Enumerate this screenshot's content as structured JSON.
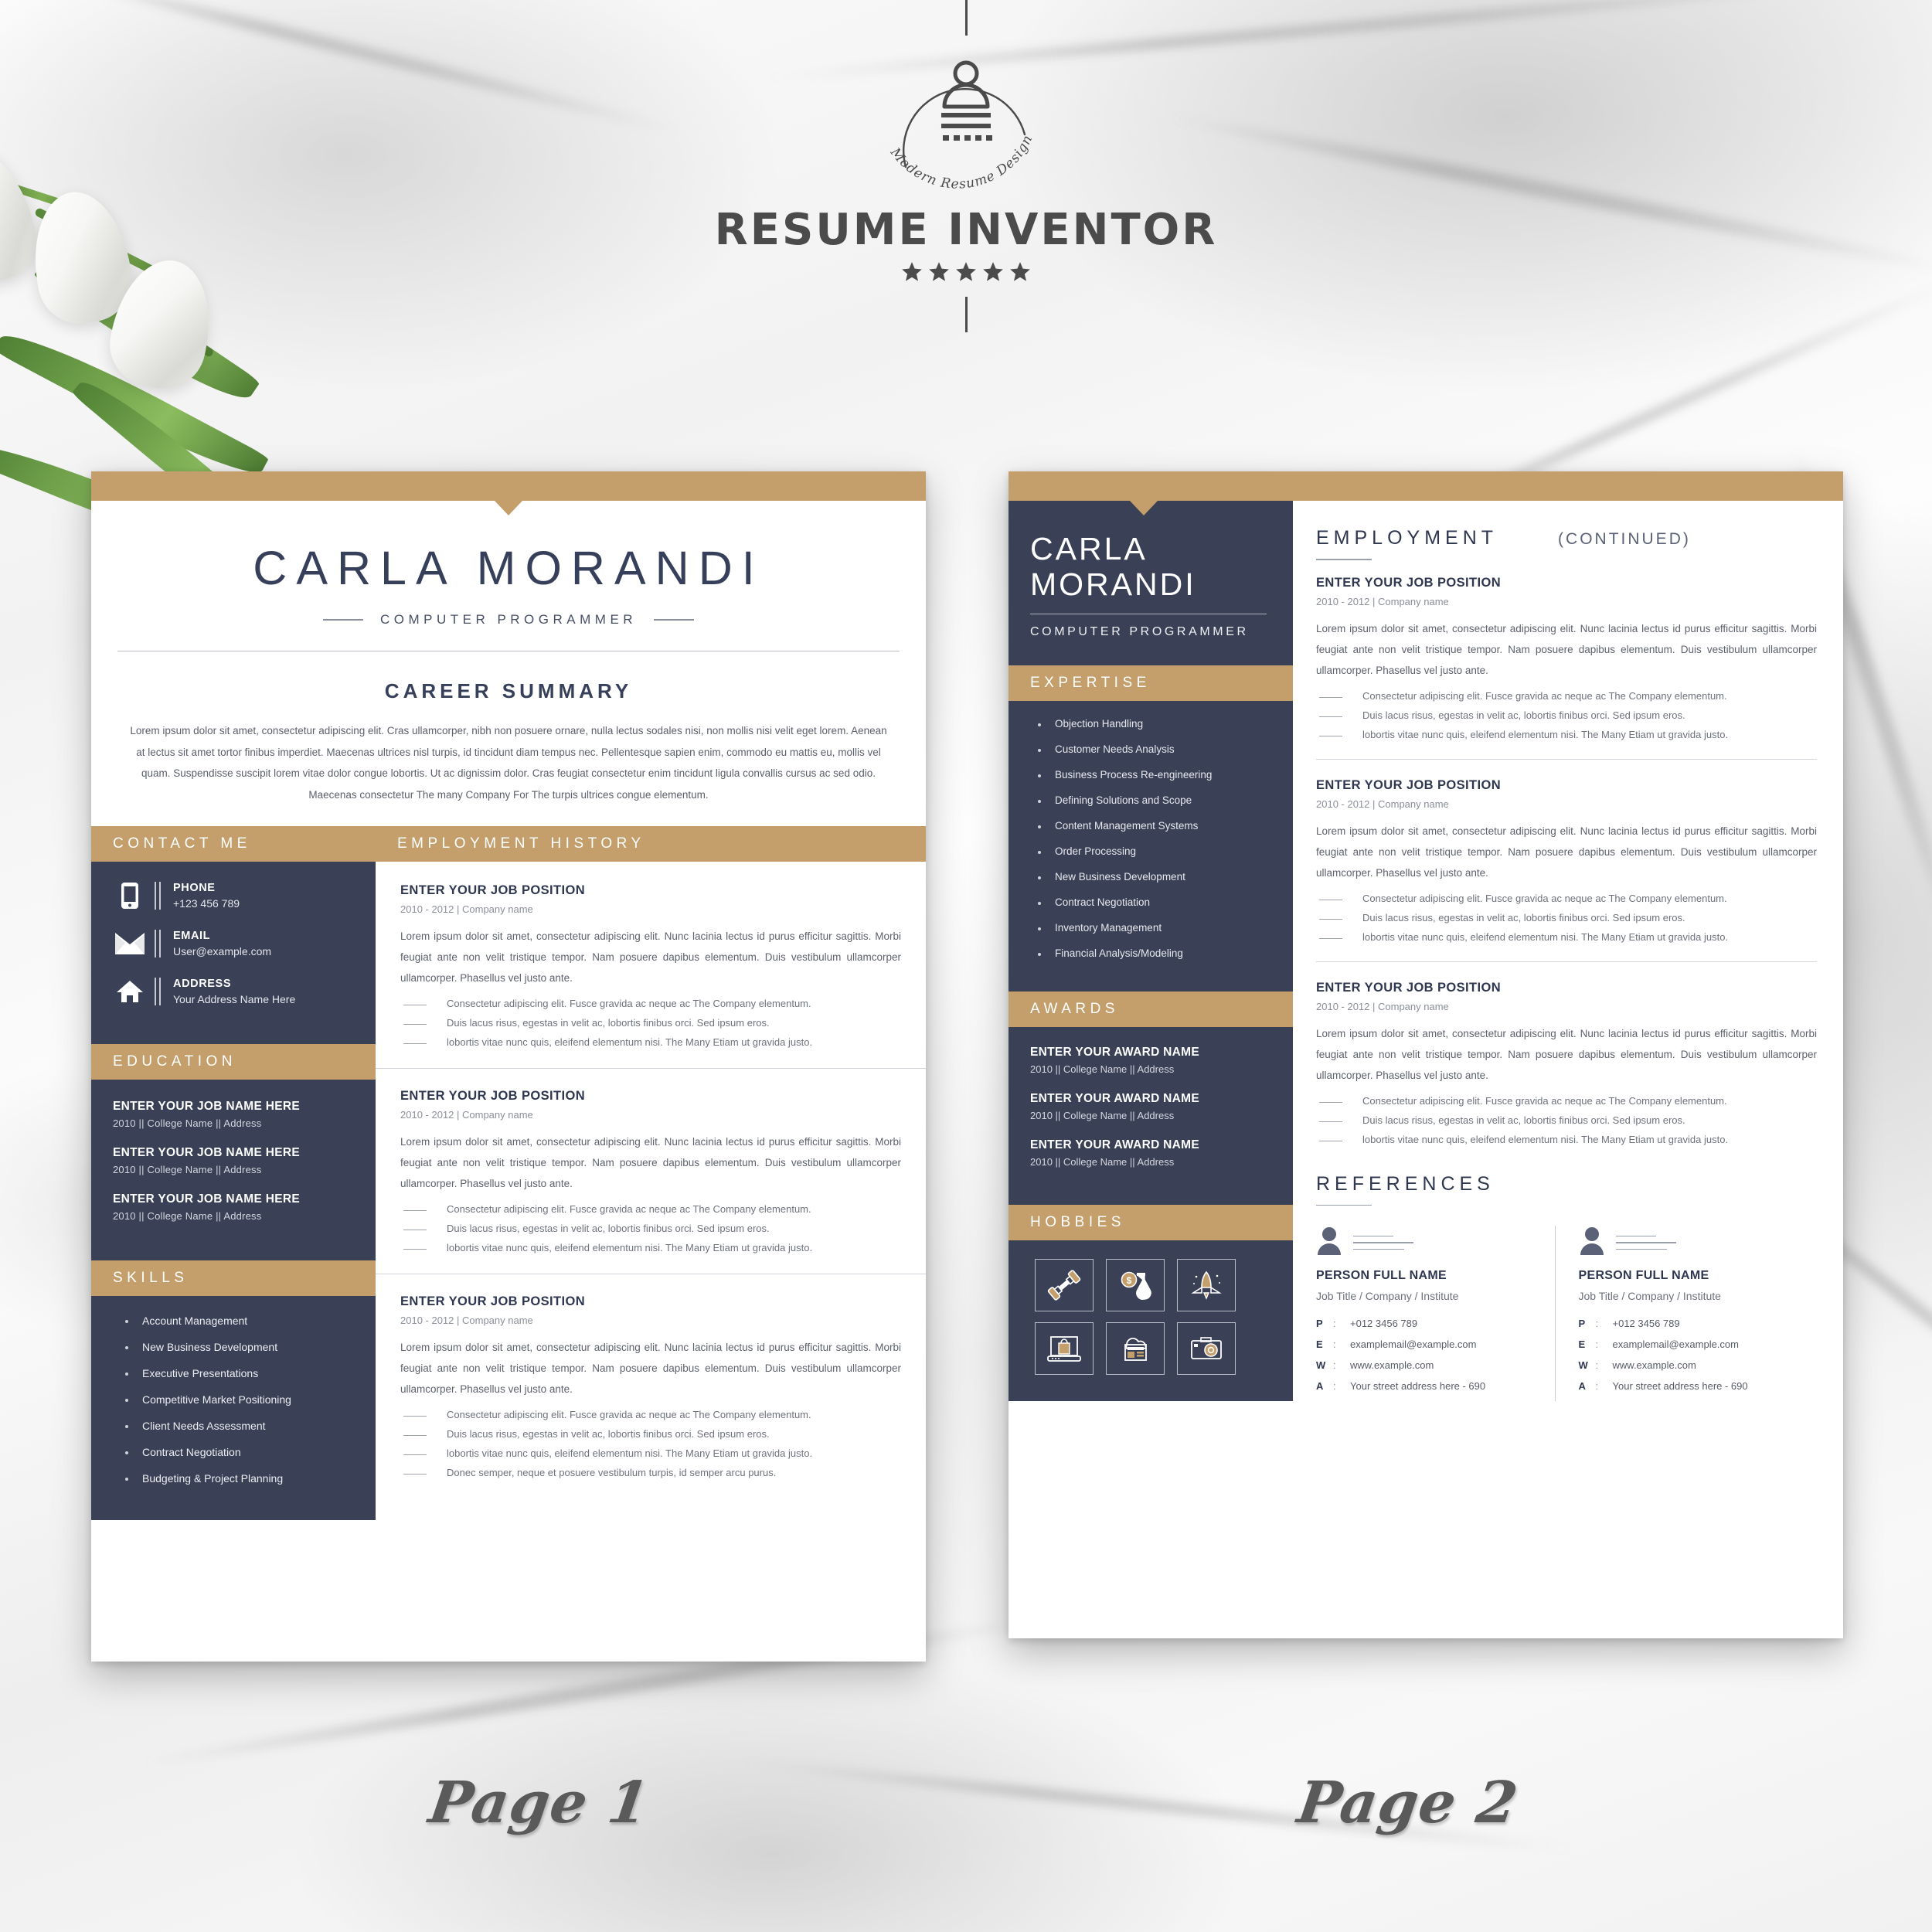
{
  "brand": {
    "name": "RESUME INVENTOR",
    "script_tagline": "Modern Resume Design",
    "stars": 5
  },
  "page_labels": {
    "page1": "Page 1",
    "page2": "Page 2"
  },
  "colors": {
    "gold": "#c49f6c",
    "navy": "#3a4156",
    "white": "#ffffff",
    "body_text": "#5d616c"
  },
  "page1": {
    "name_first": "CARLA",
    "name_last": "MORANDI",
    "role": "COMPUTER PROGRAMMER",
    "summary_heading": "CAREER SUMMARY",
    "summary_body": "Lorem ipsum dolor sit amet, consectetur adipiscing elit. Cras ullamcorper, nibh non posuere ornare, nulla lectus sodales nisi, non mollis nisi velit eget lorem. Aenean at lectus sit amet tortor finibus imperdiet. Maecenas ultrices nisl turpis, id tincidunt diam tempus nec. Pellentesque sapien enim, commodo eu mattis eu, mollis vel quam. Suspendisse suscipit lorem vitae dolor congue lobortis. Ut ac dignissim dolor. Cras feugiat consectetur enim tincidunt ligula convallis cursus ac sed odio. Maecenas consectetur The many Company For The turpis ultrices congue elementum.",
    "contact_heading": "CONTACT ME",
    "contact": [
      {
        "icon": "phone-icon",
        "label": "PHONE",
        "value": "+123 456 789"
      },
      {
        "icon": "email-icon",
        "label": "EMAIL",
        "value": "User@example.com"
      },
      {
        "icon": "address-icon",
        "label": "ADDRESS",
        "value": "Your Address Name Here"
      }
    ],
    "education_heading": "EDUCATION",
    "education": [
      {
        "name": "ENTER YOUR JOB NAME HERE",
        "meta": "2010  ||  College Name ||  Address"
      },
      {
        "name": "ENTER YOUR JOB NAME HERE",
        "meta": "2010  ||  College Name ||  Address"
      },
      {
        "name": "ENTER YOUR JOB NAME HERE",
        "meta": "2010  ||  College Name ||  Address"
      }
    ],
    "skills_heading": "SKILLS",
    "skills": [
      "Account Management",
      "New Business Development",
      "Executive Presentations",
      "Competitive Market Positioning",
      "Client Needs Assessment",
      "Contract Negotiation",
      "Budgeting & Project Planning"
    ],
    "employment_heading": "EMPLOYMENT HISTORY",
    "jobs": [
      {
        "title": "ENTER YOUR JOB POSITION",
        "meta": "2010 - 2012 | Company name",
        "body": "Lorem ipsum dolor sit amet, consectetur adipiscing elit. Nunc lacinia lectus id purus efficitur sagittis. Morbi feugiat ante non velit tristique tempor. Nam posuere dapibus elementum. Duis vestibulum ullamcorper ullamcorper. Phasellus vel justo ante.",
        "bullets": [
          "Consectetur adipiscing elit. Fusce gravida ac neque ac The  Company elementum.",
          "Duis lacus risus, egestas in velit ac, lobortis finibus orci. Sed ipsum eros.",
          "lobortis vitae nunc quis, eleifend elementum nisi. The Many Etiam ut gravida justo."
        ]
      },
      {
        "title": "ENTER YOUR JOB POSITION",
        "meta": "2010 - 2012 | Company name",
        "body": "Lorem ipsum dolor sit amet, consectetur adipiscing elit. Nunc lacinia lectus id purus efficitur sagittis. Morbi feugiat ante non velit tristique tempor. Nam posuere dapibus elementum. Duis vestibulum ullamcorper ullamcorper. Phasellus vel justo ante.",
        "bullets": [
          "Consectetur adipiscing elit. Fusce gravida ac neque ac The  Company elementum.",
          "Duis lacus risus, egestas in velit ac, lobortis finibus orci. Sed ipsum eros.",
          "lobortis vitae nunc quis, eleifend elementum nisi. The Many Etiam ut gravida justo."
        ]
      },
      {
        "title": "ENTER YOUR JOB POSITION",
        "meta": "2010 - 2012 | Company name",
        "body": "Lorem ipsum dolor sit amet, consectetur adipiscing elit. Nunc lacinia lectus id purus efficitur sagittis. Morbi feugiat ante non velit tristique tempor. Nam posuere dapibus elementum. Duis vestibulum ullamcorper ullamcorper. Phasellus vel justo ante.",
        "bullets": [
          "Consectetur adipiscing elit. Fusce gravida ac neque ac The  Company elementum.",
          "Duis lacus risus, egestas in velit ac, lobortis finibus orci. Sed ipsum eros.",
          "lobortis vitae nunc quis, eleifend elementum nisi. The Many Etiam ut gravida justo.",
          "Donec semper, neque et posuere vestibulum turpis, id semper arcu purus."
        ]
      }
    ]
  },
  "page2": {
    "name_first": "CARLA",
    "name_last": "MORANDI",
    "role": "COMPUTER PROGRAMMER",
    "expertise_heading": "EXPERTISE",
    "expertise": [
      "Objection Handling",
      "Customer Needs Analysis",
      "Business Process Re-engineering",
      "Defining Solutions and Scope",
      "Content Management Systems",
      "Order Processing",
      "New Business Development",
      "Contract Negotiation",
      "Inventory Management",
      "Financial Analysis/Modeling"
    ],
    "awards_heading": "AWARDS",
    "awards": [
      {
        "name": "ENTER YOUR AWARD NAME",
        "meta": "2010  ||  College Name ||  Address"
      },
      {
        "name": "ENTER YOUR AWARD NAME",
        "meta": "2010  ||  College Name ||  Address"
      },
      {
        "name": "ENTER YOUR AWARD NAME",
        "meta": "2010  ||  College Name ||  Address"
      }
    ],
    "hobbies_heading": "HOBBIES",
    "hobbies": [
      "fitness-dumbbell-icon",
      "finance-flask-coin-icon",
      "rocket-launch-icon",
      "online-shopping-icon",
      "cloud-web-icon",
      "photography-camera-icon"
    ],
    "employment_heading": "EMPLOYMENT",
    "employment_continued": "(CONTINUED)",
    "jobs": [
      {
        "title": "ENTER YOUR JOB POSITION",
        "meta": "2010 - 2012 | Company name",
        "body": "Lorem ipsum dolor sit amet, consectetur adipiscing elit. Nunc lacinia lectus id purus efficitur sagittis. Morbi feugiat ante non velit tristique tempor. Nam posuere dapibus elementum. Duis vestibulum ullamcorper ullamcorper. Phasellus vel justo ante.",
        "bullets": [
          "Consectetur adipiscing elit. Fusce gravida ac neque ac The  Company elementum.",
          "Duis lacus risus, egestas in velit ac, lobortis finibus orci. Sed ipsum eros.",
          "lobortis vitae nunc quis, eleifend elementum nisi. The Many Etiam ut gravida justo."
        ]
      },
      {
        "title": "ENTER YOUR JOB POSITION",
        "meta": "2010 - 2012 | Company name",
        "body": "Lorem ipsum dolor sit amet, consectetur adipiscing elit. Nunc lacinia lectus id purus efficitur sagittis. Morbi feugiat ante non velit tristique tempor. Nam posuere dapibus elementum. Duis vestibulum ullamcorper ullamcorper. Phasellus vel justo ante.",
        "bullets": [
          "Consectetur adipiscing elit. Fusce gravida ac neque ac The  Company elementum.",
          "Duis lacus risus, egestas in velit ac, lobortis finibus orci. Sed ipsum eros.",
          "lobortis vitae nunc quis, eleifend elementum nisi. The Many Etiam ut gravida justo."
        ]
      },
      {
        "title": "ENTER YOUR JOB POSITION",
        "meta": "2010 - 2012 | Company name",
        "body": "Lorem ipsum dolor sit amet, consectetur adipiscing elit. Nunc lacinia lectus id purus efficitur sagittis. Morbi feugiat ante non velit tristique tempor. Nam posuere dapibus elementum. Duis vestibulum ullamcorper ullamcorper. Phasellus vel justo ante.",
        "bullets": [
          "Consectetur adipiscing elit. Fusce gravida ac neque ac The  Company elementum.",
          "Duis lacus risus, egestas in velit ac, lobortis finibus orci. Sed ipsum eros.",
          "lobortis vitae nunc quis, eleifend elementum nisi. The Many Etiam ut gravida justo."
        ]
      }
    ],
    "references_heading": "REFERENCES",
    "references": [
      {
        "name": "PERSON FULL NAME",
        "job": "Job Title / Company / Institute",
        "rows": [
          {
            "key": "P",
            "sep": ":",
            "value": "+012 3456 789"
          },
          {
            "key": "E",
            "sep": ":",
            "value": "examplemail@example.com"
          },
          {
            "key": "W",
            "sep": ":",
            "value": "www.example.com"
          },
          {
            "key": "A",
            "sep": ":",
            "value": "Your street address here - 690"
          }
        ]
      },
      {
        "name": "PERSON FULL NAME",
        "job": "Job Title / Company / Institute",
        "rows": [
          {
            "key": "P",
            "sep": ":",
            "value": "+012 3456 789"
          },
          {
            "key": "E",
            "sep": ":",
            "value": "examplemail@example.com"
          },
          {
            "key": "W",
            "sep": ":",
            "value": "www.example.com"
          },
          {
            "key": "A",
            "sep": ":",
            "value": "Your street address here - 690"
          }
        ]
      }
    ]
  }
}
